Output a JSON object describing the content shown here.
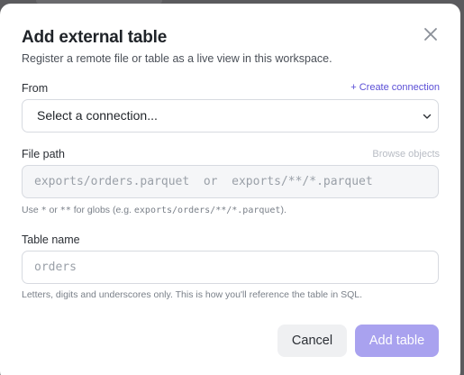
{
  "dialog": {
    "title": "Add external table",
    "subtitle": "Register a remote file or table as a live view in this workspace.",
    "close_icon": "close-icon"
  },
  "from": {
    "label": "From",
    "create_link": "+ Create connection",
    "select_value": "Select a connection..."
  },
  "file_path": {
    "label": "File path",
    "browse_link": "Browse objects",
    "placeholder": "exports/orders.parquet  or  exports/**/*.parquet",
    "hint_prefix": "Use ",
    "hint_glob1": "*",
    "hint_or": " or ",
    "hint_glob2": "**",
    "hint_middle": " for globs (e.g. ",
    "hint_example": "exports/orders/**/*.parquet",
    "hint_suffix": ")."
  },
  "table_name": {
    "label": "Table name",
    "placeholder": "orders",
    "hint": "Letters, digits and underscores only. This is how you'll reference the table in SQL."
  },
  "actions": {
    "cancel_label": "Cancel",
    "add_label": "Add table"
  },
  "colors": {
    "accent": "#5b4fd6",
    "primary_disabled": "#a9a2ef"
  }
}
